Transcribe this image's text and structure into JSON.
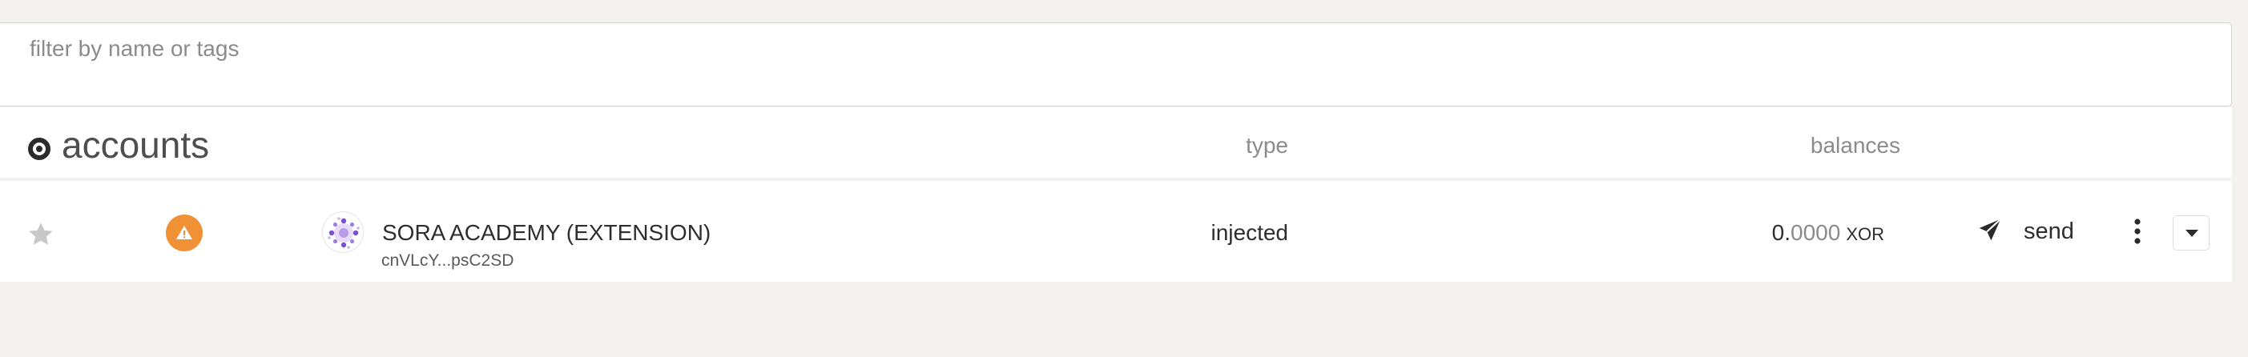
{
  "filter": {
    "placeholder": "filter by name or tags",
    "value": ""
  },
  "header": {
    "title": "accounts",
    "columns": {
      "type": "type",
      "balances": "balances"
    }
  },
  "accounts": [
    {
      "name": "SORA ACADEMY (EXTENSION)",
      "address": "cnVLcY...psC2SD",
      "type": "injected",
      "balance_integer": "0.",
      "balance_decimal": "0000",
      "balance_unit": "XOR",
      "send_label": "send",
      "favorite": false,
      "icons": {
        "favorite": "star-icon",
        "warning": "warning-icon",
        "avatar": "identicon",
        "send": "paper-plane-icon",
        "more": "vertical-dots-icon",
        "expand": "caret-down-icon"
      }
    }
  ],
  "colors": {
    "page_background": "#f3f2f1",
    "warning": "#f19135",
    "star_inactive": "#c8c8c8",
    "avatar_accent": "#7b4fd3",
    "text_primary": "#2e2e2e",
    "text_muted": "#8b8b8b"
  }
}
